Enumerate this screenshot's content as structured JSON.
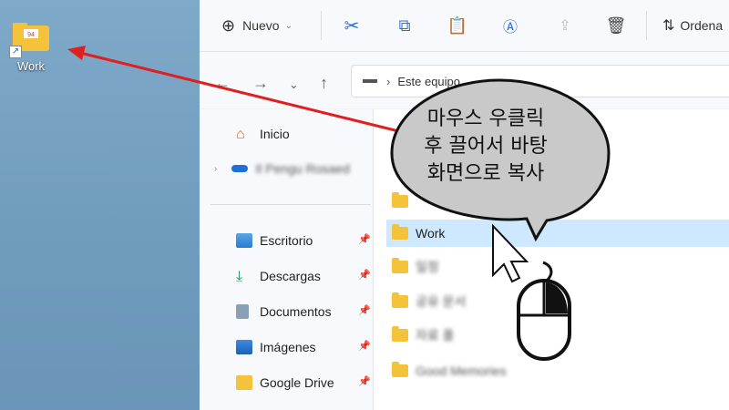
{
  "desktop": {
    "shortcut_label": "Work",
    "folder_badge": "94"
  },
  "toolbar": {
    "new_label": "Nuevo",
    "sort_label": "Ordena"
  },
  "address": {
    "path": "Este equipo"
  },
  "sidebar": {
    "items": [
      {
        "label": "Inicio"
      },
      {
        "label": "Il Pengu Rosaed"
      },
      {
        "label": "Escritorio"
      },
      {
        "label": "Descargas"
      },
      {
        "label": "Documentos"
      },
      {
        "label": "Imágenes"
      },
      {
        "label": "Google Drive"
      }
    ]
  },
  "files": {
    "rows": [
      {
        "label": ""
      },
      {
        "label": "Work",
        "selected": true
      },
      {
        "label": "일정"
      },
      {
        "label": "공유 문서"
      },
      {
        "label": "자료 폴"
      },
      {
        "label": "Good Memories"
      }
    ]
  },
  "callout": {
    "line1": "마우스 우클릭",
    "line2": "후 끌어서 바탕",
    "line3": "화면으로 복사"
  },
  "colors": {
    "arrow": "#e02020",
    "selection": "#cde8ff",
    "folder": "#f5c33b"
  }
}
